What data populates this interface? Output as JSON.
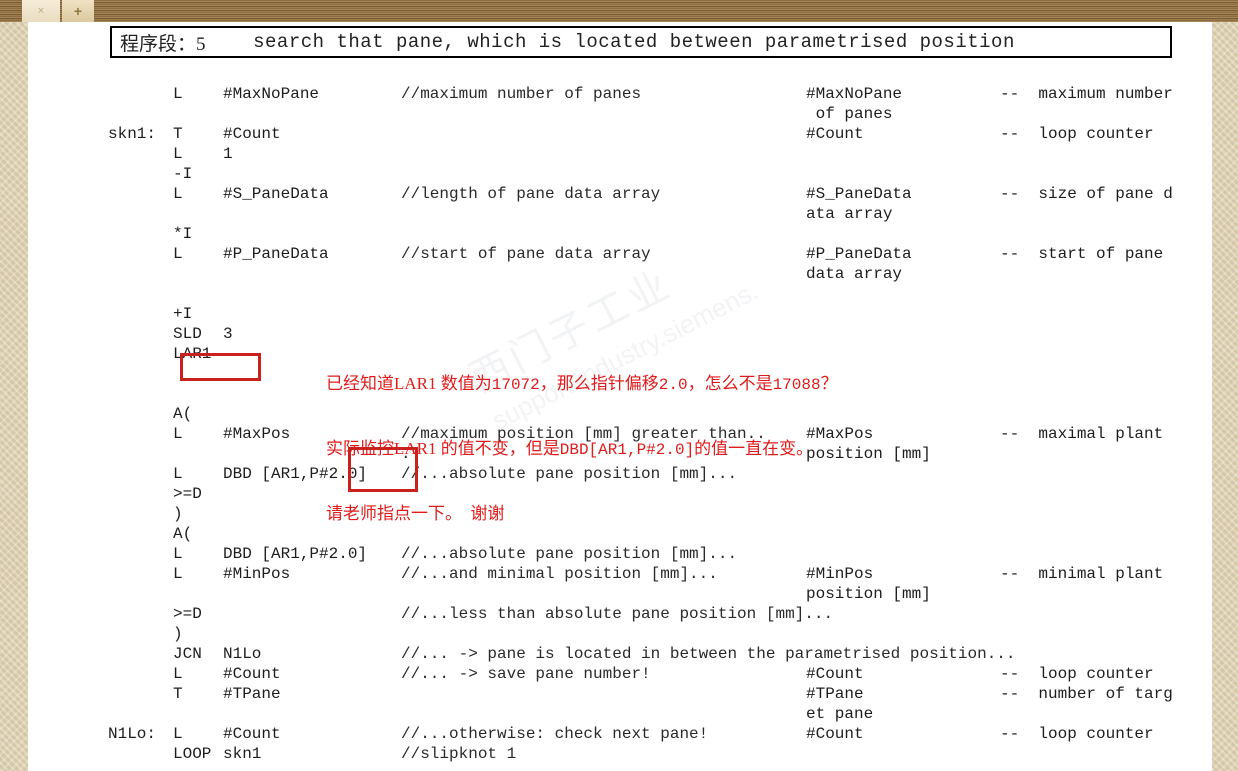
{
  "browser": {
    "close_tab_icon": "close-icon",
    "close_tab_label": "×",
    "new_tab_icon": "plus-icon",
    "new_tab_label": "+"
  },
  "watermark": {
    "logo_text": "西门子工业",
    "url_text": "support.industry.siemens."
  },
  "header": {
    "network_label": "程序段：5",
    "spacer": "    ",
    "title": "search that pane, which is located between parametrised position"
  },
  "annotation": {
    "line1_a": "已经知道LAR1 数值为",
    "line1_num1": "17072",
    "line1_b": "，那么指针偏移",
    "line1_num2": "2.0",
    "line1_c": "，怎么不是",
    "line1_num3": "17088",
    "line1_d": "？",
    "line2_a": "实际监控LAR1 的值不变，但是",
    "line2_code": "DBD[AR1,P#2.0]",
    "line2_b": "的值一直在变。",
    "line3": "请老师指点一下。  谢谢",
    "color": "#e01b1b"
  },
  "highlights": [
    {
      "name": "lar1-highlight",
      "label": "LAR1",
      "color": "#c9211e"
    },
    {
      "name": "p2-0-highlight",
      "label": "P#2.0",
      "color": "#c9211e"
    }
  ],
  "code": {
    "lines": [
      {
        "label": "",
        "op": "L",
        "arg": "#MaxNoPane",
        "comment": "//maximum number of panes",
        "symbol": "#MaxNoPane",
        "desc": "--  maximum number"
      },
      {
        "label": "",
        "op": "",
        "arg": "",
        "comment": "",
        "symbol": " of panes",
        "desc": ""
      },
      {
        "label": "skn1:",
        "op": "T",
        "arg": "#Count",
        "comment": "",
        "symbol": "#Count",
        "desc": "--  loop counter"
      },
      {
        "label": "",
        "op": "L",
        "arg": "1",
        "comment": "",
        "symbol": "",
        "desc": ""
      },
      {
        "label": "",
        "op": "-I",
        "arg": "",
        "comment": "",
        "symbol": "",
        "desc": ""
      },
      {
        "label": "",
        "op": "L",
        "arg": "#S_PaneData",
        "comment": "//length of pane data array",
        "symbol": "#S_PaneData",
        "desc": "--  size of pane d"
      },
      {
        "label": "",
        "op": "",
        "arg": "",
        "comment": "",
        "symbol": "ata array",
        "desc": ""
      },
      {
        "label": "",
        "op": "*I",
        "arg": "",
        "comment": "",
        "symbol": "",
        "desc": ""
      },
      {
        "label": "",
        "op": "L",
        "arg": "#P_PaneData",
        "comment": "//start of pane data array",
        "symbol": "#P_PaneData",
        "desc": "--  start of pane"
      },
      {
        "label": "",
        "op": "",
        "arg": "",
        "comment": "",
        "symbol": "data array",
        "desc": ""
      },
      {
        "label": "",
        "op": "",
        "arg": "",
        "comment": "",
        "symbol": "",
        "desc": ""
      },
      {
        "label": "",
        "op": "+I",
        "arg": "",
        "comment": "",
        "symbol": "",
        "desc": ""
      },
      {
        "label": "",
        "op": "SLD",
        "arg": "3",
        "comment": "",
        "symbol": "",
        "desc": ""
      },
      {
        "label": "",
        "op": "LAR1",
        "arg": "",
        "comment": "",
        "symbol": "",
        "desc": ""
      },
      {
        "label": "",
        "op": "",
        "arg": "",
        "comment": "",
        "symbol": "",
        "desc": ""
      },
      {
        "label": "",
        "op": "",
        "arg": "",
        "comment": "",
        "symbol": "",
        "desc": ""
      },
      {
        "label": "",
        "op": "A(",
        "arg": "",
        "comment": "",
        "symbol": "",
        "desc": ""
      },
      {
        "label": "",
        "op": "L",
        "arg": "#MaxPos",
        "comment": "//maximum position [mm] greater than..",
        "symbol": "#MaxPos",
        "desc": "--  maximal plant"
      },
      {
        "label": "",
        "op": "",
        "arg": "",
        "comment": ".",
        "symbol": "position [mm]",
        "desc": ""
      },
      {
        "label": "",
        "op": "L",
        "arg": "DBD [AR1,P#2.0]",
        "comment": "//...absolute pane position [mm]...",
        "symbol": "",
        "desc": ""
      },
      {
        "label": "",
        "op": ">=D",
        "arg": "",
        "comment": "",
        "symbol": "",
        "desc": ""
      },
      {
        "label": "",
        "op": ")",
        "arg": "",
        "comment": "",
        "symbol": "",
        "desc": ""
      },
      {
        "label": "",
        "op": "A(",
        "arg": "",
        "comment": "",
        "symbol": "",
        "desc": ""
      },
      {
        "label": "",
        "op": "L",
        "arg": "DBD [AR1,P#2.0]",
        "comment": "//...absolute pane position [mm]...",
        "symbol": "",
        "desc": ""
      },
      {
        "label": "",
        "op": "L",
        "arg": "#MinPos",
        "comment": "//...and minimal position [mm]...",
        "symbol": "#MinPos",
        "desc": "--  minimal plant"
      },
      {
        "label": "",
        "op": "",
        "arg": "",
        "comment": "",
        "symbol": "position [mm]",
        "desc": ""
      },
      {
        "label": "",
        "op": ">=D",
        "arg": "",
        "comment": "//...less than absolute pane position [mm]...",
        "symbol": "",
        "desc": ""
      },
      {
        "label": "",
        "op": ")",
        "arg": "",
        "comment": "",
        "symbol": "",
        "desc": ""
      },
      {
        "label": "",
        "op": "JCN",
        "arg": "N1Lo",
        "comment": "//... -> pane is located in between the parametrised position...",
        "symbol": "",
        "desc": ""
      },
      {
        "label": "",
        "op": "L",
        "arg": "#Count",
        "comment": "//... -> save pane number!",
        "symbol": "#Count",
        "desc": "--  loop counter"
      },
      {
        "label": "",
        "op": "T",
        "arg": "#TPane",
        "comment": "",
        "symbol": "#TPane",
        "desc": "--  number of targ"
      },
      {
        "label": "",
        "op": "",
        "arg": "",
        "comment": "",
        "symbol": "et pane",
        "desc": ""
      },
      {
        "label": "N1Lo:",
        "op": "L",
        "arg": "#Count",
        "comment": "//...otherwise: check next pane!",
        "symbol": "#Count",
        "desc": "--  loop counter"
      },
      {
        "label": "",
        "op": "LOOP",
        "arg": "skn1",
        "comment": "//slipknot 1",
        "symbol": "",
        "desc": ""
      }
    ]
  }
}
